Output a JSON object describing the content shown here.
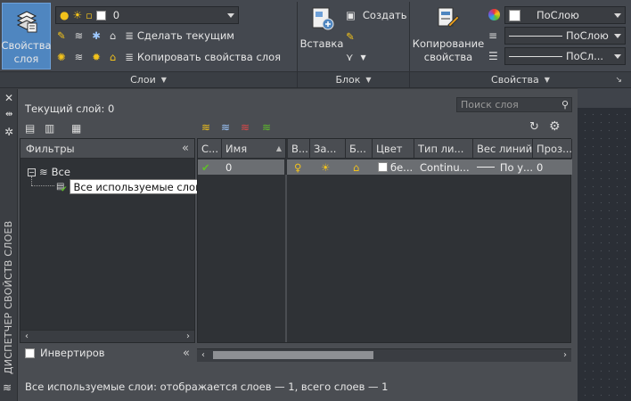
{
  "ribbon": {
    "layers_panel": {
      "title": "Слои",
      "properties_button": {
        "line1": "Свойства",
        "line2": "слоя"
      },
      "layer_dropdown_value": "0",
      "make_current_label": "Сделать текущим",
      "match_layer_label": "Копировать свойства слоя"
    },
    "block_panel": {
      "title": "Блок",
      "insert_label": "Вставка",
      "create_label": "Создать"
    },
    "properties_panel": {
      "title": "Свойства",
      "match_button": {
        "line1": "Копирование",
        "line2": "свойства"
      },
      "color_value": "ПоСлою",
      "linetype_value": "ПоСлою",
      "lineweight_value": "ПоСл..."
    }
  },
  "palette": {
    "vertical_title": "ДИСПЕТЧЕР СВОЙСТВ СЛОЕВ",
    "current_layer": "Текущий слой: 0",
    "search_placeholder": "Поиск слоя",
    "filters_header": "Фильтры",
    "tree": {
      "root": "Все",
      "child": "Все используемые слои"
    },
    "invert_label": "Инвертиров",
    "columns": [
      "С...",
      "Имя",
      "В...",
      "За...",
      "Б...",
      "Цвет",
      "Тип ли...",
      "Вес линий",
      "Проз..."
    ],
    "rows": [
      {
        "name": "0",
        "color": "бе...",
        "linetype": "Continu...",
        "lineweight": "По у...",
        "transparency": "0"
      }
    ],
    "status": "Все используемые слои: отображается слоев — 1, всего слоев — 1"
  },
  "colors": {
    "ribbon_bg": "#44484f",
    "palette_bg": "#4a4d52",
    "pane_bg": "#2f3236",
    "selected_row": "#6b6e72",
    "active_button": "#4f86c0",
    "accent_yellow": "#f2c21b",
    "accent_green": "#5fbf2a"
  }
}
